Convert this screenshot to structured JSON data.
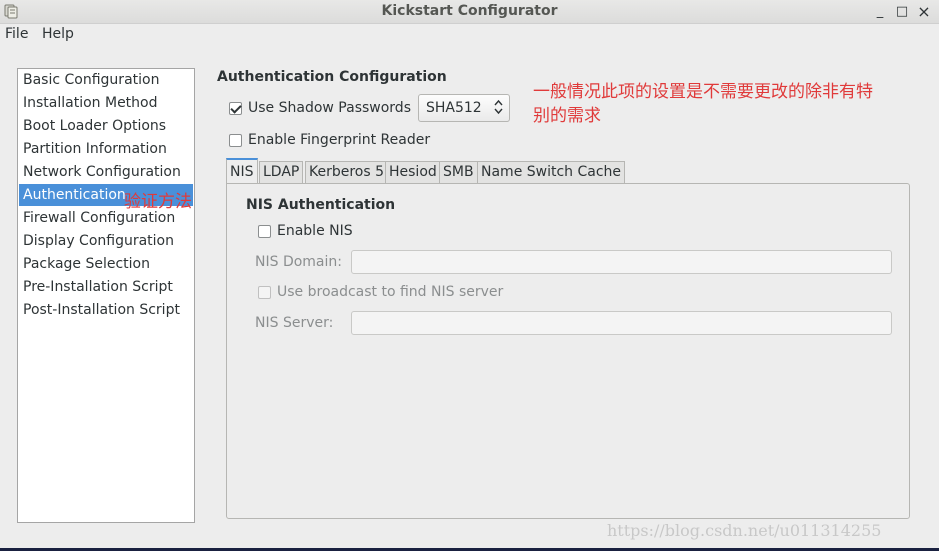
{
  "window": {
    "title": "Kickstart Configurator",
    "minimize": "_",
    "maximize": "□",
    "close": "×"
  },
  "menu": {
    "file": "File",
    "help": "Help"
  },
  "sidebar": {
    "items": [
      {
        "label": "Basic Configuration"
      },
      {
        "label": "Installation Method"
      },
      {
        "label": "Boot Loader Options"
      },
      {
        "label": "Partition Information"
      },
      {
        "label": "Network Configuration"
      },
      {
        "label": "Authentication",
        "selected": true
      },
      {
        "label": "Firewall Configuration"
      },
      {
        "label": "Display Configuration"
      },
      {
        "label": "Package Selection"
      },
      {
        "label": "Pre-Installation Script"
      },
      {
        "label": "Post-Installation Script"
      }
    ]
  },
  "annotations": {
    "auth_note": "验证方法",
    "top_note_line1": "一般情况此项的设置是不需要更改的除非有特",
    "top_note_line2": "别的需求"
  },
  "auth": {
    "title": "Authentication Configuration",
    "shadow_label": "Use Shadow Passwords",
    "shadow_checked": true,
    "hash_value": "SHA512",
    "fingerprint_label": "Enable Fingerprint Reader",
    "fingerprint_checked": false
  },
  "tabs": [
    {
      "label": "NIS",
      "active": true
    },
    {
      "label": "LDAP"
    },
    {
      "label": "Kerberos 5"
    },
    {
      "label": "Hesiod"
    },
    {
      "label": "SMB"
    },
    {
      "label": "Name Switch Cache"
    }
  ],
  "nis": {
    "title": "NIS Authentication",
    "enable_label": "Enable NIS",
    "enable_checked": false,
    "domain_label": "NIS Domain:",
    "domain_value": "",
    "broadcast_label": "Use broadcast to find NIS server",
    "server_label": "NIS Server:",
    "server_value": ""
  },
  "watermark": "https://blog.csdn.net/u011314255"
}
